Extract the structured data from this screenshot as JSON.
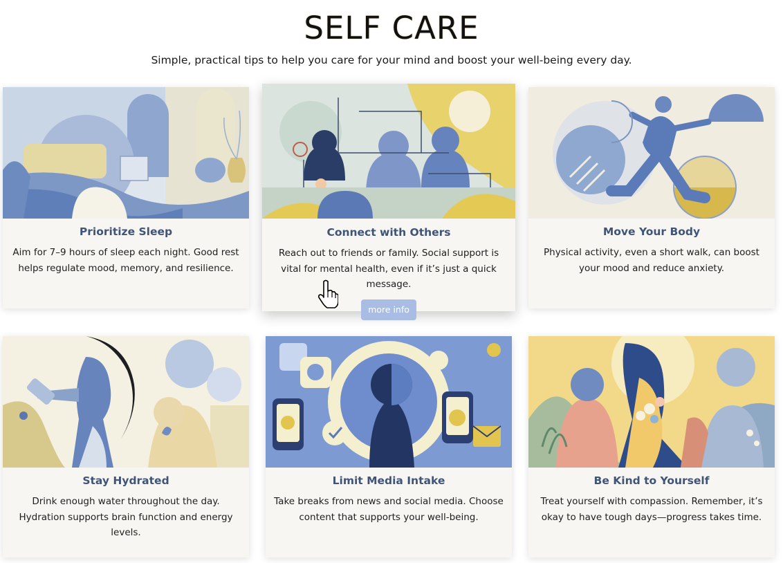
{
  "page": {
    "title": "SELF CARE",
    "subtitle": "Simple, practical tips to help you care for your mind and boost your well-being every day."
  },
  "cards": [
    {
      "title": "Prioritize Sleep",
      "text": "Aim for 7–9 hours of sleep each night. Good rest helps regulate mood, memory, and resilience."
    },
    {
      "title": "Connect with Others",
      "text": "Reach out to friends or family. Social support is vital for mental health, even if it’s just a quick message.",
      "button": "more info"
    },
    {
      "title": "Move Your Body",
      "text": "Physical activity, even a short walk, can boost your mood and reduce anxiety."
    },
    {
      "title": "Stay Hydrated",
      "text": "Drink enough water throughout the day. Hydration supports brain function and energy levels."
    },
    {
      "title": "Limit Media Intake",
      "text": "Take breaks from news and social media. Choose content that supports your well-being."
    },
    {
      "title": "Be Kind to Yourself",
      "text": "Treat yourself with compassion. Remember, it’s okay to have tough days—progress takes time."
    }
  ],
  "colors": {
    "accent_title": "#3e5478",
    "button_bg": "#a9bde4",
    "card_bg": "#f8f6f3"
  }
}
